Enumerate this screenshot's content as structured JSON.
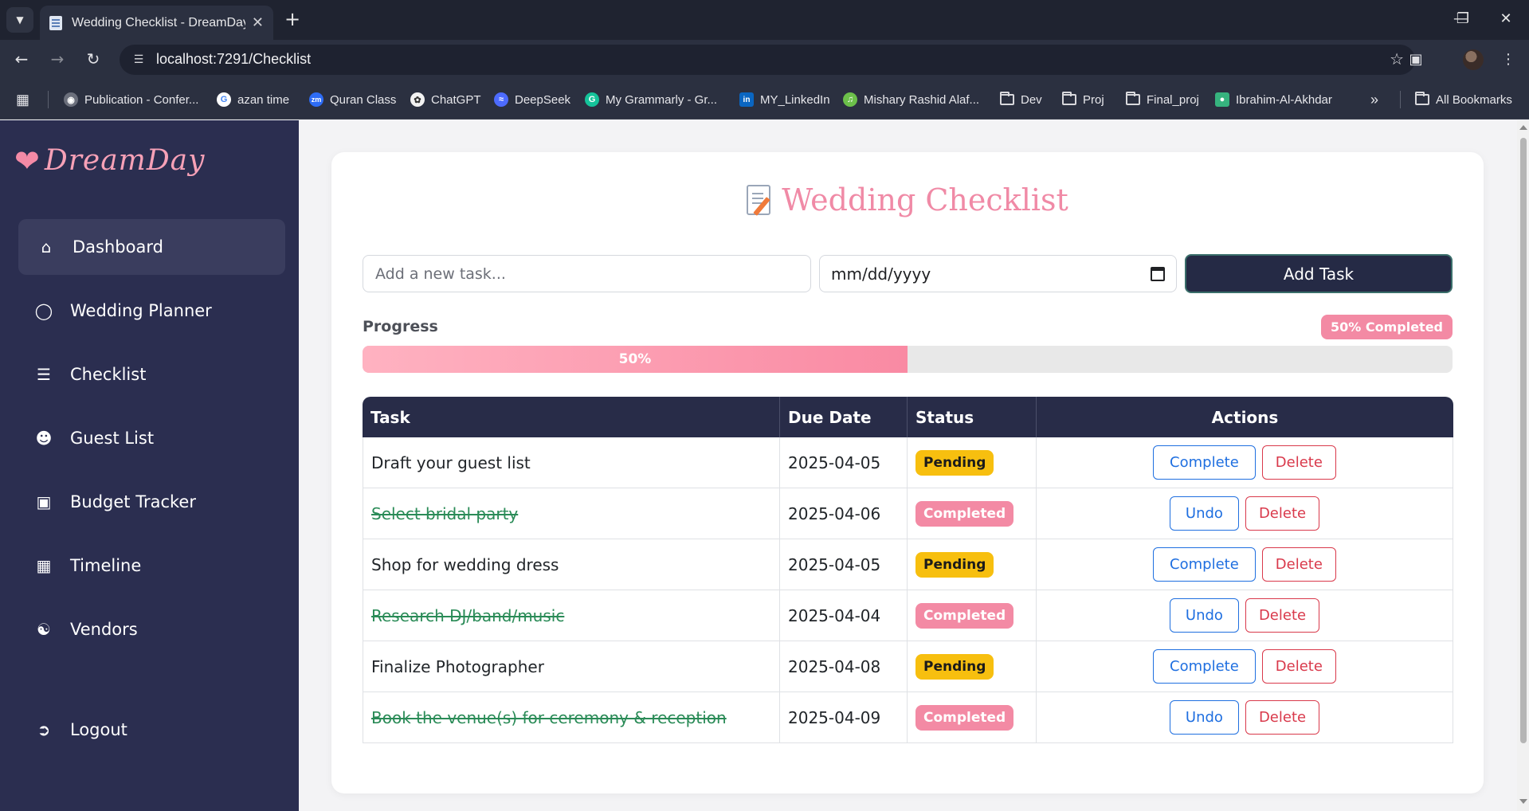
{
  "browser": {
    "tab_title": "Wedding Checklist - DreamDay",
    "url": "localhost:7291/Checklist",
    "bookmarks": [
      {
        "label": "Publication - Confer...",
        "icon": "globe-icon"
      },
      {
        "label": "azan time",
        "icon": "google-icon"
      },
      {
        "label": "Quran Class",
        "icon": "zoom-icon"
      },
      {
        "label": "ChatGPT",
        "icon": "chatgpt-icon"
      },
      {
        "label": "DeepSeek",
        "icon": "deepseek-icon"
      },
      {
        "label": "My Grammarly - Gr...",
        "icon": "grammarly-icon"
      },
      {
        "label": "MY_LinkedIn",
        "icon": "linkedin-icon"
      },
      {
        "label": "Mishary Rashid Alaf...",
        "icon": "audio-icon"
      },
      {
        "label": "Dev",
        "icon": "folder-icon"
      },
      {
        "label": "Proj",
        "icon": "folder-icon"
      },
      {
        "label": "Final_proj",
        "icon": "folder-icon"
      },
      {
        "label": "Ibrahim-Al-Akhdar",
        "icon": "site-icon"
      }
    ],
    "all_bookmarks": "All Bookmarks"
  },
  "sidebar": {
    "brand": "DreamDay",
    "items": [
      {
        "label": "Dashboard",
        "icon": "home-icon"
      },
      {
        "label": "Wedding Planner",
        "icon": "ring-icon"
      },
      {
        "label": "Checklist",
        "icon": "list-check-icon"
      },
      {
        "label": "Guest List",
        "icon": "users-icon"
      },
      {
        "label": "Budget Tracker",
        "icon": "wallet-icon"
      },
      {
        "label": "Timeline",
        "icon": "calendar-icon"
      },
      {
        "label": "Vendors",
        "icon": "handshake-icon"
      }
    ],
    "logout": "Logout"
  },
  "page": {
    "title": "Wedding Checklist",
    "task_placeholder": "Add a new task...",
    "date_placeholder": "mm/dd/yyyy",
    "add_button": "Add Task",
    "progress_label": "Progress",
    "progress_badge": "50% Completed",
    "progress_text": "50%",
    "progress_value": 0.5
  },
  "table": {
    "headers": [
      "Task",
      "Due Date",
      "Status",
      "Actions"
    ],
    "rows": [
      {
        "task": "Draft your guest list",
        "due": "2025-04-05",
        "status": "Pending",
        "done": false,
        "primary": "Complete",
        "secondary": "Delete"
      },
      {
        "task": "Select bridal party",
        "due": "2025-04-06",
        "status": "Completed",
        "done": true,
        "primary": "Undo",
        "secondary": "Delete"
      },
      {
        "task": "Shop for wedding dress",
        "due": "2025-04-05",
        "status": "Pending",
        "done": false,
        "primary": "Complete",
        "secondary": "Delete"
      },
      {
        "task": "Research DJ/band/music",
        "due": "2025-04-04",
        "status": "Completed",
        "done": true,
        "primary": "Undo",
        "secondary": "Delete"
      },
      {
        "task": "Finalize Photographer",
        "due": "2025-04-08",
        "status": "Pending",
        "done": false,
        "primary": "Complete",
        "secondary": "Delete"
      },
      {
        "task": "Book the venue(s) for ceremony & reception",
        "due": "2025-04-09",
        "status": "Completed",
        "done": true,
        "primary": "Undo",
        "secondary": "Delete"
      }
    ]
  },
  "colors": {
    "sidebar_bg": "#2b2e50",
    "accent_pink": "#f38aa4",
    "pending_yellow": "#f7bf0f",
    "done_green": "#2a8b57"
  }
}
